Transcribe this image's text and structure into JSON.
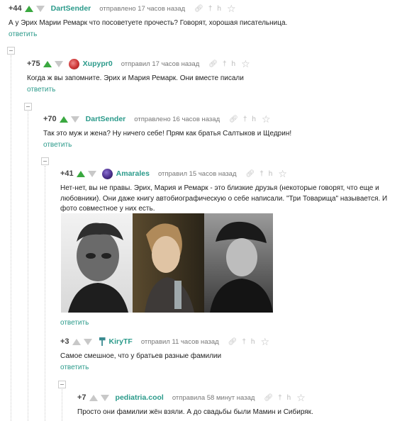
{
  "comments": [
    {
      "rating": "+44",
      "user": "DartSender",
      "sent": "отправлено 17 часов назад",
      "text": "А у Эрих Марии Ремарк что посоветуете прочесть? Говорят, хорошая писательница.",
      "reply": "ответить"
    },
    {
      "rating": "+75",
      "user": "Xupypr0",
      "sent": "отправил 17 часов назад",
      "text": "Когда ж вы запомните. Эрих и Мария Ремарк. Они вместе писали",
      "reply": "ответить"
    },
    {
      "rating": "+70",
      "user": "DartSender",
      "sent": "отправлено 16 часов назад",
      "text": "Так это муж и жена? Ну ничего себе! Прям как братья Салтыков и Щедрин!",
      "reply": "ответить"
    },
    {
      "rating": "+41",
      "user": "Amarales",
      "sent": "отправил 15 часов назад",
      "text": "Нет-нет, вы не правы. Эрих, Мария и Ремарк - это близкие друзья (некоторые говорят, что еще и любовники). Они даже книгу автобиографическую о себе написали. \"Три Товарища\" называется. И фото совместное у них есть.",
      "reply": "ответить"
    },
    {
      "rating": "+3",
      "user": "KiryTF",
      "sent": "отправил 11 часов назад",
      "text": "Самое смешное, что у братьев разные фамилии",
      "reply": "ответить"
    },
    {
      "rating": "+7",
      "user": "pediatria.cool",
      "sent": "отправила 58 минут назад",
      "text": "Просто они фамилии жён взяли. А до свадьбы были Мамин и Сибиряк."
    }
  ],
  "icons": {
    "link": "link-icon",
    "comment": "comment-icon",
    "save": "save-icon",
    "star": "star-icon"
  },
  "colors": {
    "accent": "#2a9a8a",
    "upvote": "#3aa840"
  }
}
